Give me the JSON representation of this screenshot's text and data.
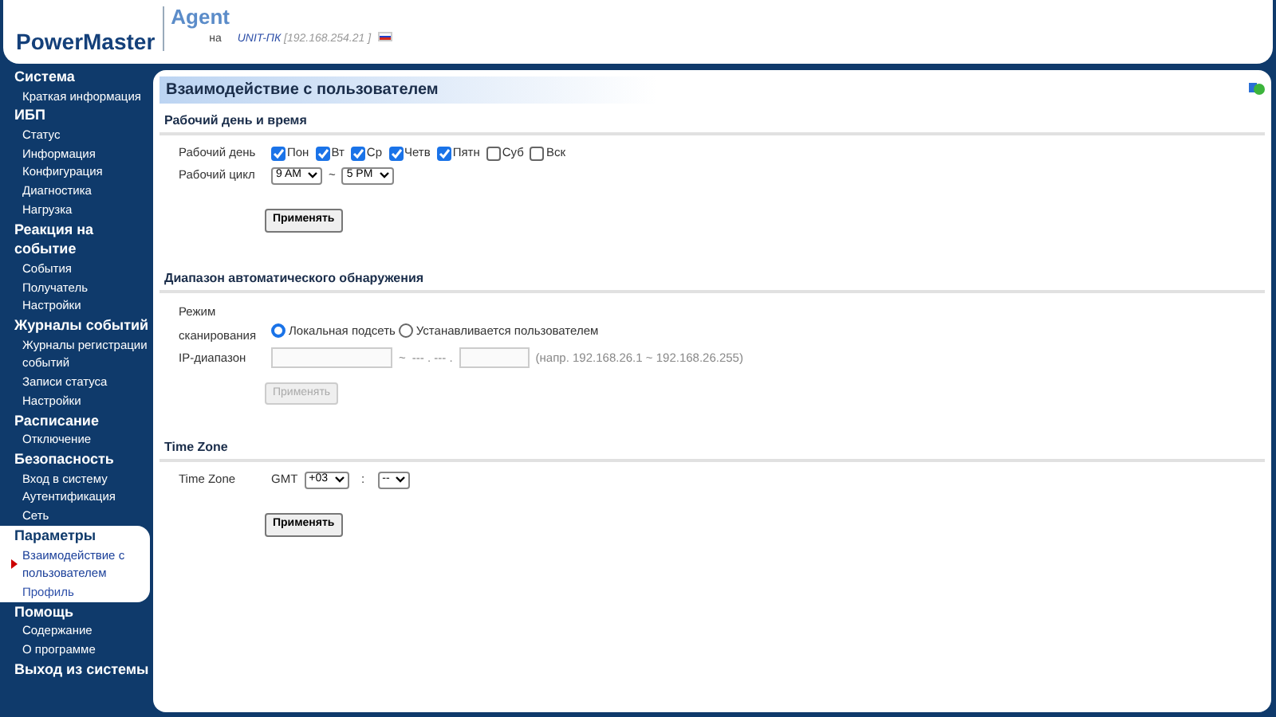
{
  "header": {
    "logo": "PowerMaster",
    "product": "Agent",
    "on_label": "на",
    "host": "UNIT-ПК",
    "bracket_open": "[",
    "address": "192.168.254.21",
    "bracket_close": "]"
  },
  "sidebar": {
    "groups": [
      {
        "title": "Система",
        "selected": false,
        "items": [
          {
            "label": "Краткая информация",
            "selected": false
          }
        ]
      },
      {
        "title": "ИБП",
        "selected": false,
        "items": [
          {
            "label": "Статус",
            "selected": false
          },
          {
            "label": "Информация",
            "selected": false
          },
          {
            "label": "Конфигурация",
            "selected": false
          },
          {
            "label": "Диагностика",
            "selected": false
          },
          {
            "label": "Нагрузка",
            "selected": false
          }
        ]
      },
      {
        "title": "Реакция на событие",
        "selected": false,
        "items": [
          {
            "label": "События",
            "selected": false
          },
          {
            "label": "Получатель",
            "selected": false
          },
          {
            "label": "Настройки",
            "selected": false
          }
        ]
      },
      {
        "title": "Журналы событий",
        "selected": false,
        "items": [
          {
            "label": "Журналы регистрации событий",
            "selected": false
          },
          {
            "label": "Записи статуса",
            "selected": false
          },
          {
            "label": "Настройки",
            "selected": false
          }
        ]
      },
      {
        "title": "Расписание",
        "selected": false,
        "items": [
          {
            "label": "Отключение",
            "selected": false
          }
        ]
      },
      {
        "title": "Безопасность",
        "selected": false,
        "items": [
          {
            "label": "Вход в систему",
            "selected": false
          },
          {
            "label": "Аутентификация",
            "selected": false
          },
          {
            "label": "Сеть",
            "selected": false
          }
        ]
      },
      {
        "title": "Параметры",
        "selected": true,
        "items": [
          {
            "label": "Взаимодействие с пользователем",
            "selected": true
          },
          {
            "label": "Профиль",
            "selected": false
          }
        ]
      },
      {
        "title": "Помощь",
        "selected": false,
        "items": [
          {
            "label": "Содержание",
            "selected": false
          },
          {
            "label": "О программе",
            "selected": false
          }
        ]
      },
      {
        "title": "Выход из системы",
        "selected": false
      }
    ]
  },
  "page": {
    "title": "Взаимодействие с пользователем",
    "sections": [
      {
        "kind": "workday",
        "heading": "Рабочий день и время",
        "day_label": "Рабочий день",
        "days": [
          {
            "label": "Пон",
            "checked": true
          },
          {
            "label": "Вт",
            "checked": true
          },
          {
            "label": "Ср",
            "checked": true
          },
          {
            "label": "Четв",
            "checked": true
          },
          {
            "label": "Пятн",
            "checked": true
          },
          {
            "label": "Суб",
            "checked": false
          },
          {
            "label": "Вск",
            "checked": false
          }
        ],
        "cycle_label": "Рабочий цикл",
        "cycle_from": "9 AM",
        "separator": "~",
        "cycle_to": "5 PM",
        "button": {
          "label": "Применять",
          "disabled": false
        }
      },
      {
        "kind": "discovery",
        "heading": "Диапазон автоматического обнаружения",
        "mode_label": "Режим сканирования",
        "modes": [
          {
            "label": "Локальная подсеть",
            "selected": true
          },
          {
            "label": "Устанавливается пользователем",
            "selected": false
          }
        ],
        "ip_label": "IP-диапазон",
        "separator": "~",
        "ip_mask": "--- . --- .",
        "hint": "(напр. 192.168.26.1 ~ 192.168.26.255)",
        "button": {
          "label": "Применять",
          "disabled": true
        }
      },
      {
        "kind": "timezone",
        "heading": "Time Zone",
        "tz_label": "Time Zone",
        "prefix": "GMT",
        "hour": "+03",
        "colon": ":",
        "minute": "--",
        "button": {
          "label": "Применять",
          "disabled": false
        }
      }
    ]
  }
}
